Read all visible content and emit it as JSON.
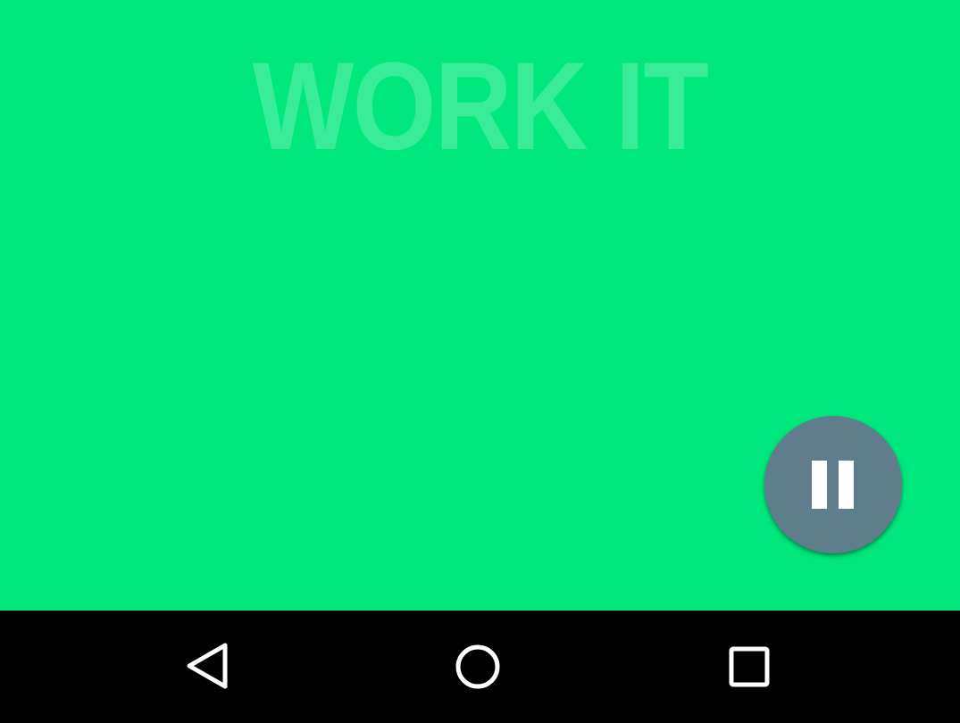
{
  "screen": {
    "title": "WORK IT"
  },
  "controls": {
    "pause_icon": "pause-icon"
  },
  "navbar": {
    "back_icon": "back-triangle-icon",
    "home_icon": "home-circle-icon",
    "recents_icon": "recents-square-icon"
  },
  "colors": {
    "background": "#00E77E",
    "fab": "#607D8B",
    "navbar": "#000000"
  }
}
